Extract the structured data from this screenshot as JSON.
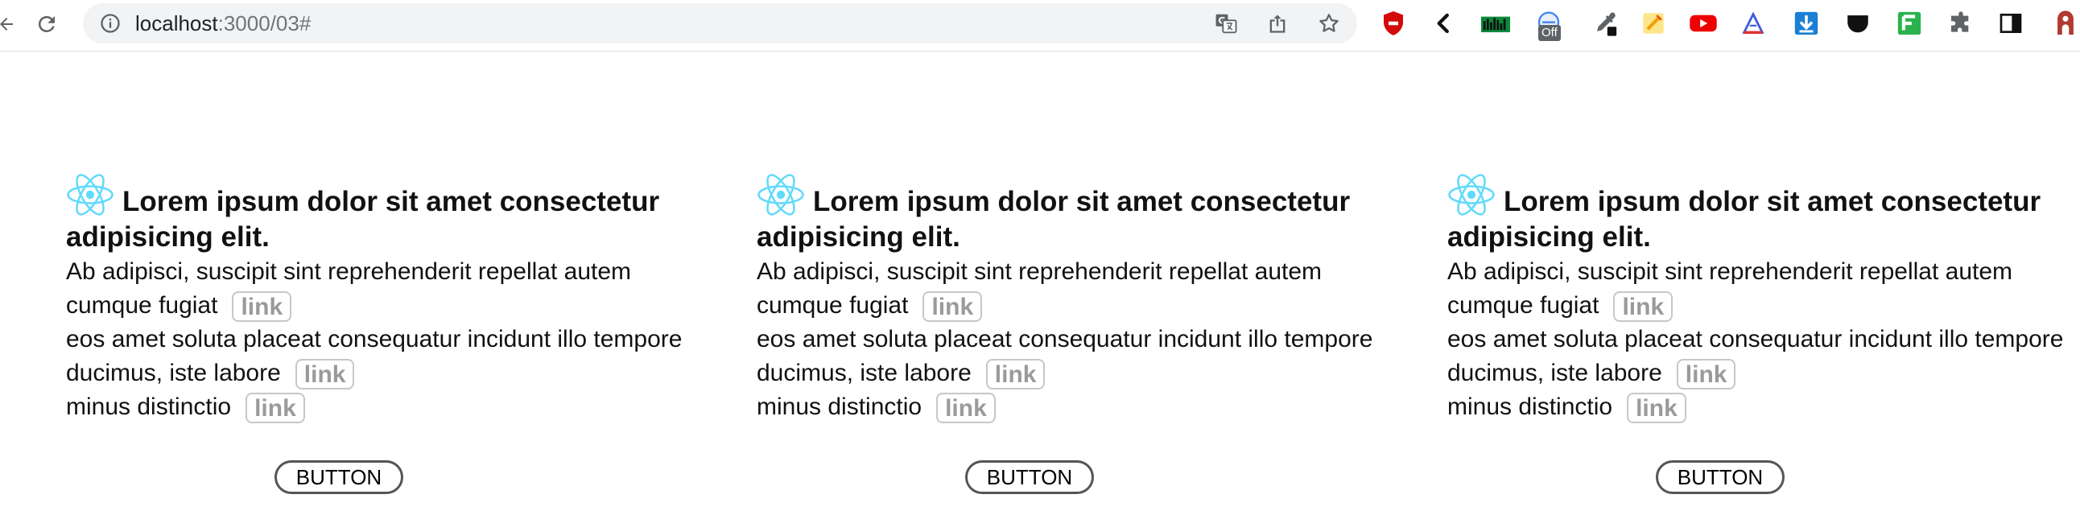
{
  "browser": {
    "url_host": "localhost",
    "url_path": ":3000/03#",
    "extension_badge": "Off",
    "icons": [
      "back-icon",
      "reload-icon",
      "site-info-icon",
      "translate-icon",
      "share-icon",
      "bookmark-star-icon",
      "ublock-icon",
      "left-chevron-icon",
      "equalizer-icon",
      "wallet-off-icon",
      "eyedropper-icon",
      "notes-icon",
      "youtube-icon",
      "ruler-triangle-icon",
      "download-arrow-icon",
      "pocket-icon",
      "feedly-icon",
      "extensions-puzzle-icon",
      "side-panel-icon",
      "profile-icon"
    ]
  },
  "colors": {
    "react": "#61dafb",
    "link_border": "#c7c7c7",
    "link_text": "#9a9a9a",
    "button_border": "#555555"
  },
  "cards": [
    {
      "heading": "Lorem ipsum dolor sit amet consectetur adipisicing elit.",
      "line1": "Ab adipisci, suscipit sint reprehenderit repellat autem cumque fugiat",
      "line2": "eos amet soluta placeat consequatur incidunt illo tempore ducimus, iste labore",
      "line3": "minus distinctio",
      "link_label": "link",
      "button_label": "BUTTON"
    },
    {
      "heading": "Lorem ipsum dolor sit amet consectetur adipisicing elit.",
      "line1": "Ab adipisci, suscipit sint reprehenderit repellat autem cumque fugiat",
      "line2": "eos amet soluta placeat consequatur incidunt illo tempore ducimus, iste labore",
      "line3": "minus distinctio",
      "link_label": "link",
      "button_label": "BUTTON"
    },
    {
      "heading": "Lorem ipsum dolor sit amet consectetur adipisicing elit.",
      "line1": "Ab adipisci, suscipit sint reprehenderit repellat autem cumque fugiat",
      "line2": "eos amet soluta placeat consequatur incidunt illo tempore ducimus, iste labore",
      "line3": "minus distinctio",
      "link_label": "link",
      "button_label": "BUTTON"
    }
  ]
}
